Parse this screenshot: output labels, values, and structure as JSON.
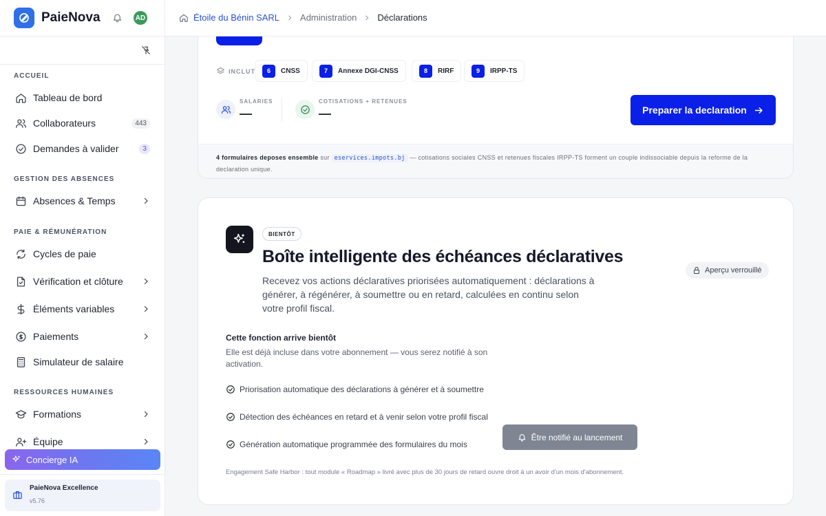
{
  "app": {
    "name": "PaieNova",
    "avatar_initials": "AD"
  },
  "breadcrumb": [
    "Étoile du Bénin SARL",
    "Administration",
    "Déclarations"
  ],
  "sidebar": {
    "sections": [
      {
        "label": "ACCUEIL"
      },
      {
        "label": "GESTION DES ABSENCES"
      },
      {
        "label": "PAIE & RÉMUNÉRATION"
      },
      {
        "label": "RESSOURCES HUMAINES"
      }
    ],
    "items": [
      {
        "label": "Tableau de bord"
      },
      {
        "label": "Collaborateurs",
        "badge": "443"
      },
      {
        "label": "Demandes à valider",
        "badge": "3"
      },
      {
        "label": "Absences & Temps"
      },
      {
        "label": "Cycles de paie"
      },
      {
        "label": "Vérification et clôture"
      },
      {
        "label": "Éléments variables"
      },
      {
        "label": "Paiements"
      },
      {
        "label": "Simulateur de salaire"
      },
      {
        "label": "Formations"
      },
      {
        "label": "Équipe"
      }
    ],
    "concierge_label": "Concierge IA",
    "plan": {
      "name": "PaieNova Excellence",
      "version": "v5.76"
    }
  },
  "declaration_card": {
    "includes_label": "INCLUT",
    "chips": [
      {
        "num": "6",
        "label": "CNSS"
      },
      {
        "num": "7",
        "label": "Annexe DGI-CNSS"
      },
      {
        "num": "8",
        "label": "RIRF"
      },
      {
        "num": "9",
        "label": "IRPP-TS"
      }
    ],
    "stats": [
      {
        "label": "SALARIES",
        "value": "—"
      },
      {
        "label": "COTISATIONS + RETENUES",
        "value": "—"
      }
    ],
    "prepare_button": "Preparer la declaration",
    "footer": {
      "bold": "4 formulaires deposes ensemble",
      "on": "sur",
      "site": "eservices.impots.bj",
      "rest": "— cotisations sociales CNSS et retenues fiscales IRPP-TS forment un couple indissociable depuis la reforme de la declaration unique."
    }
  },
  "feature_card": {
    "badge": "BIENTÔT",
    "title": "Boîte intelligente des échéances déclaratives",
    "description": "Recevez vos actions déclaratives priorisées automatiquement : déclarations à générer, à régénérer, à soumettre ou en retard, calculées en continu selon votre profil fiscal.",
    "locked_label": "Aperçu verrouillé",
    "coming_title": "Cette fonction arrive bientôt",
    "coming_desc": "Elle est déjà incluse dans votre abonnement — vous serez notifié à son activation.",
    "features": [
      "Priorisation automatique des déclarations à générer et à soumettre",
      "Détection des échéances en retard et à venir selon votre profil fiscal",
      "Génération automatique programmée des formulaires du mois"
    ],
    "notify_button": "Être notifié au lancement",
    "safe_harbor": "Engagement Safe Harbor : tout module « Roadmap » livré avec plus de 30 jours de retard ouvre droit à un avoir d'un mois d'abonnement."
  },
  "colors": {
    "primary": "#0a1fe8",
    "accent_link": "#2451d6",
    "avatar": "#3b9a5a"
  }
}
